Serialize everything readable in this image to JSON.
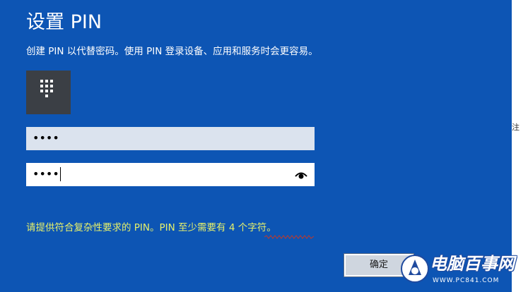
{
  "dialog": {
    "title": "设置 PIN",
    "description": "创建 PIN 以代替密码。使用 PIN 登录设备、应用和服务时会更容易。",
    "pin_icon": "keypad-icon"
  },
  "fields": {
    "new_pin": {
      "value": "••••",
      "state": "filled"
    },
    "confirm_pin": {
      "value": "••••",
      "state": "focused",
      "reveal_icon": "eye-icon"
    }
  },
  "error_message": "请提供符合复杂性要求的 PIN。PIN 至少需要有 4 个字符。",
  "buttons": {
    "ok_label": "确定"
  },
  "right_strip_glyph": "注",
  "watermark": {
    "name": "电脑百事网",
    "url": "WWW.PC841.COM",
    "logo_icon": "pc841-logo-icon"
  },
  "colors": {
    "dialog_background": "#0d55b4",
    "error_text": "#e6f06a",
    "tile_background": "#3b3f45"
  }
}
